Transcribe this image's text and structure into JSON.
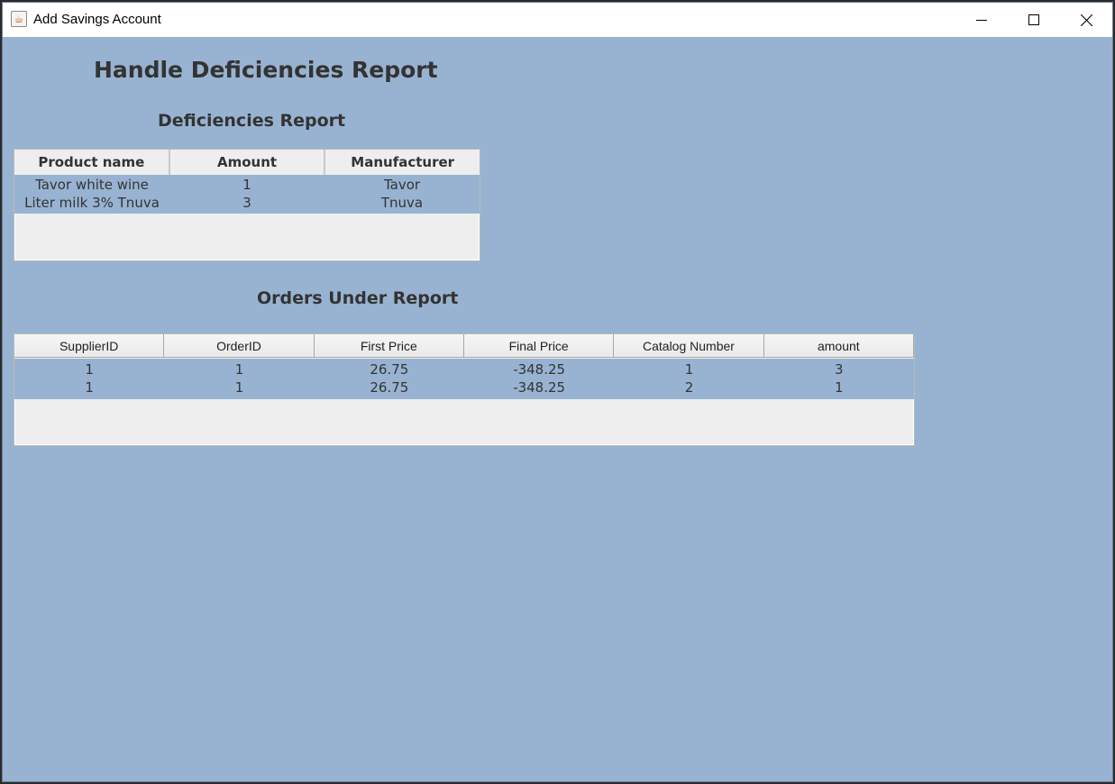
{
  "window": {
    "title": "Add Savings Account",
    "app_icon": "java-cup-icon",
    "controls": [
      "minimize-icon",
      "maximize-icon",
      "close-icon"
    ]
  },
  "page": {
    "title": "Handle Deficiencies Report",
    "background": "#98b3d1"
  },
  "deficiencies": {
    "heading": "Deficiencies Report",
    "columns": [
      "Product name",
      "Amount",
      "Manufacturer"
    ],
    "rows": [
      [
        "Tavor white wine",
        "1",
        "Tavor"
      ],
      [
        "Liter milk 3% Tnuva",
        "3",
        "Tnuva"
      ]
    ]
  },
  "orders": {
    "heading": "Orders Under Report",
    "columns": [
      "SupplierID",
      "OrderID",
      "First Price",
      "Final Price",
      "Catalog Number",
      "amount"
    ],
    "rows": [
      [
        "1",
        "1",
        "26.75",
        "-348.25",
        "1",
        "3"
      ],
      [
        "1",
        "1",
        "26.75",
        "-348.25",
        "2",
        "1"
      ]
    ]
  }
}
